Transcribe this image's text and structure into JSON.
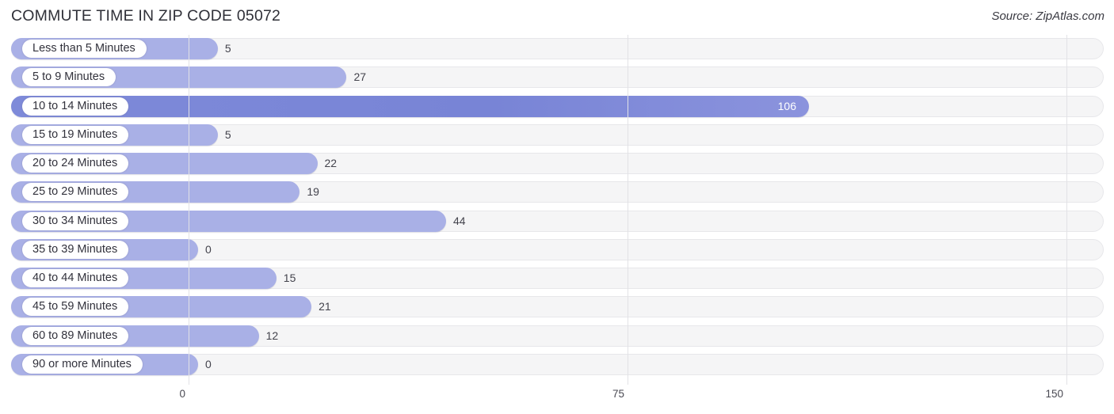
{
  "header": {
    "title": "COMMUTE TIME IN ZIP CODE 05072",
    "source": "Source: ZipAtlas.com"
  },
  "axis": {
    "ticks": [
      "0",
      "75",
      "150"
    ],
    "tick_values": [
      0,
      75,
      150
    ]
  },
  "colors": {
    "bar_light": "#a9b0e6",
    "bar_strong": "#7884d6",
    "track": "#f5f5f6",
    "gridline": "#e2e2e6",
    "text": "#3c3c46"
  },
  "chart_data": {
    "type": "bar",
    "orientation": "horizontal",
    "title": "COMMUTE TIME IN ZIP CODE 05072",
    "xlabel": "",
    "ylabel": "",
    "xlim": [
      0,
      150
    ],
    "grid": true,
    "legend": false,
    "source": "Source: ZipAtlas.com",
    "categories": [
      "Less than 5 Minutes",
      "5 to 9 Minutes",
      "10 to 14 Minutes",
      "15 to 19 Minutes",
      "20 to 24 Minutes",
      "25 to 29 Minutes",
      "30 to 34 Minutes",
      "35 to 39 Minutes",
      "40 to 44 Minutes",
      "45 to 59 Minutes",
      "60 to 89 Minutes",
      "90 or more Minutes"
    ],
    "values": [
      5,
      27,
      106,
      5,
      22,
      19,
      44,
      0,
      15,
      21,
      12,
      0
    ],
    "value_labels": [
      "5",
      "27",
      "106",
      "5",
      "22",
      "19",
      "44",
      "0",
      "15",
      "21",
      "12",
      "0"
    ]
  }
}
